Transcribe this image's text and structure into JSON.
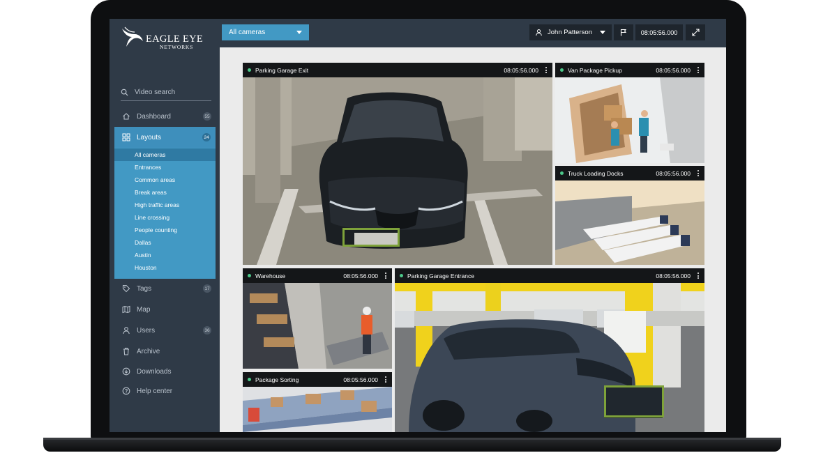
{
  "brand": {
    "name": "EAGLE EYE",
    "sub": "NETWORKS"
  },
  "colors": {
    "accent": "#4299c4",
    "sidebar": "#2f3a47",
    "status_dot": "#4cc98a",
    "detect_box": "#7ea23a"
  },
  "sidebar": {
    "search_label": "Video search",
    "nav": [
      {
        "label": "Dashboard",
        "icon": "home-icon",
        "badge": "55"
      },
      {
        "label": "Layouts",
        "icon": "grid-icon",
        "badge": "24"
      },
      {
        "label": "Tags",
        "icon": "tag-icon",
        "badge": "17"
      },
      {
        "label": "Map",
        "icon": "map-icon",
        "badge": ""
      },
      {
        "label": "Users",
        "icon": "user-icon",
        "badge": "36"
      },
      {
        "label": "Archive",
        "icon": "archive-icon",
        "badge": ""
      },
      {
        "label": "Downloads",
        "icon": "download-icon",
        "badge": ""
      },
      {
        "label": "Help center",
        "icon": "help-icon",
        "badge": ""
      }
    ],
    "layouts": [
      "All cameras",
      "Entrances",
      "Common areas",
      "Break areas",
      "High traffic areas",
      "Line crossing",
      "People counting",
      "Dallas",
      "Austin",
      "Houston"
    ],
    "active_layout": "All cameras"
  },
  "topbar": {
    "camera_select": "All cameras",
    "user_name": "John Patterson",
    "time": "08:05:56.000"
  },
  "tiles": [
    {
      "name": "Parking Garage Exit",
      "time": "08:05:56.000"
    },
    {
      "name": "Van Package Pickup",
      "time": "08:05:56.000"
    },
    {
      "name": "Truck Loading Docks",
      "time": "08:05:56.000"
    },
    {
      "name": "Warehouse",
      "time": "08:05:56.000"
    },
    {
      "name": "Parking Garage Entrance",
      "time": "08:05:56.000"
    },
    {
      "name": "Package Sorting",
      "time": "08:05:56.000"
    }
  ]
}
